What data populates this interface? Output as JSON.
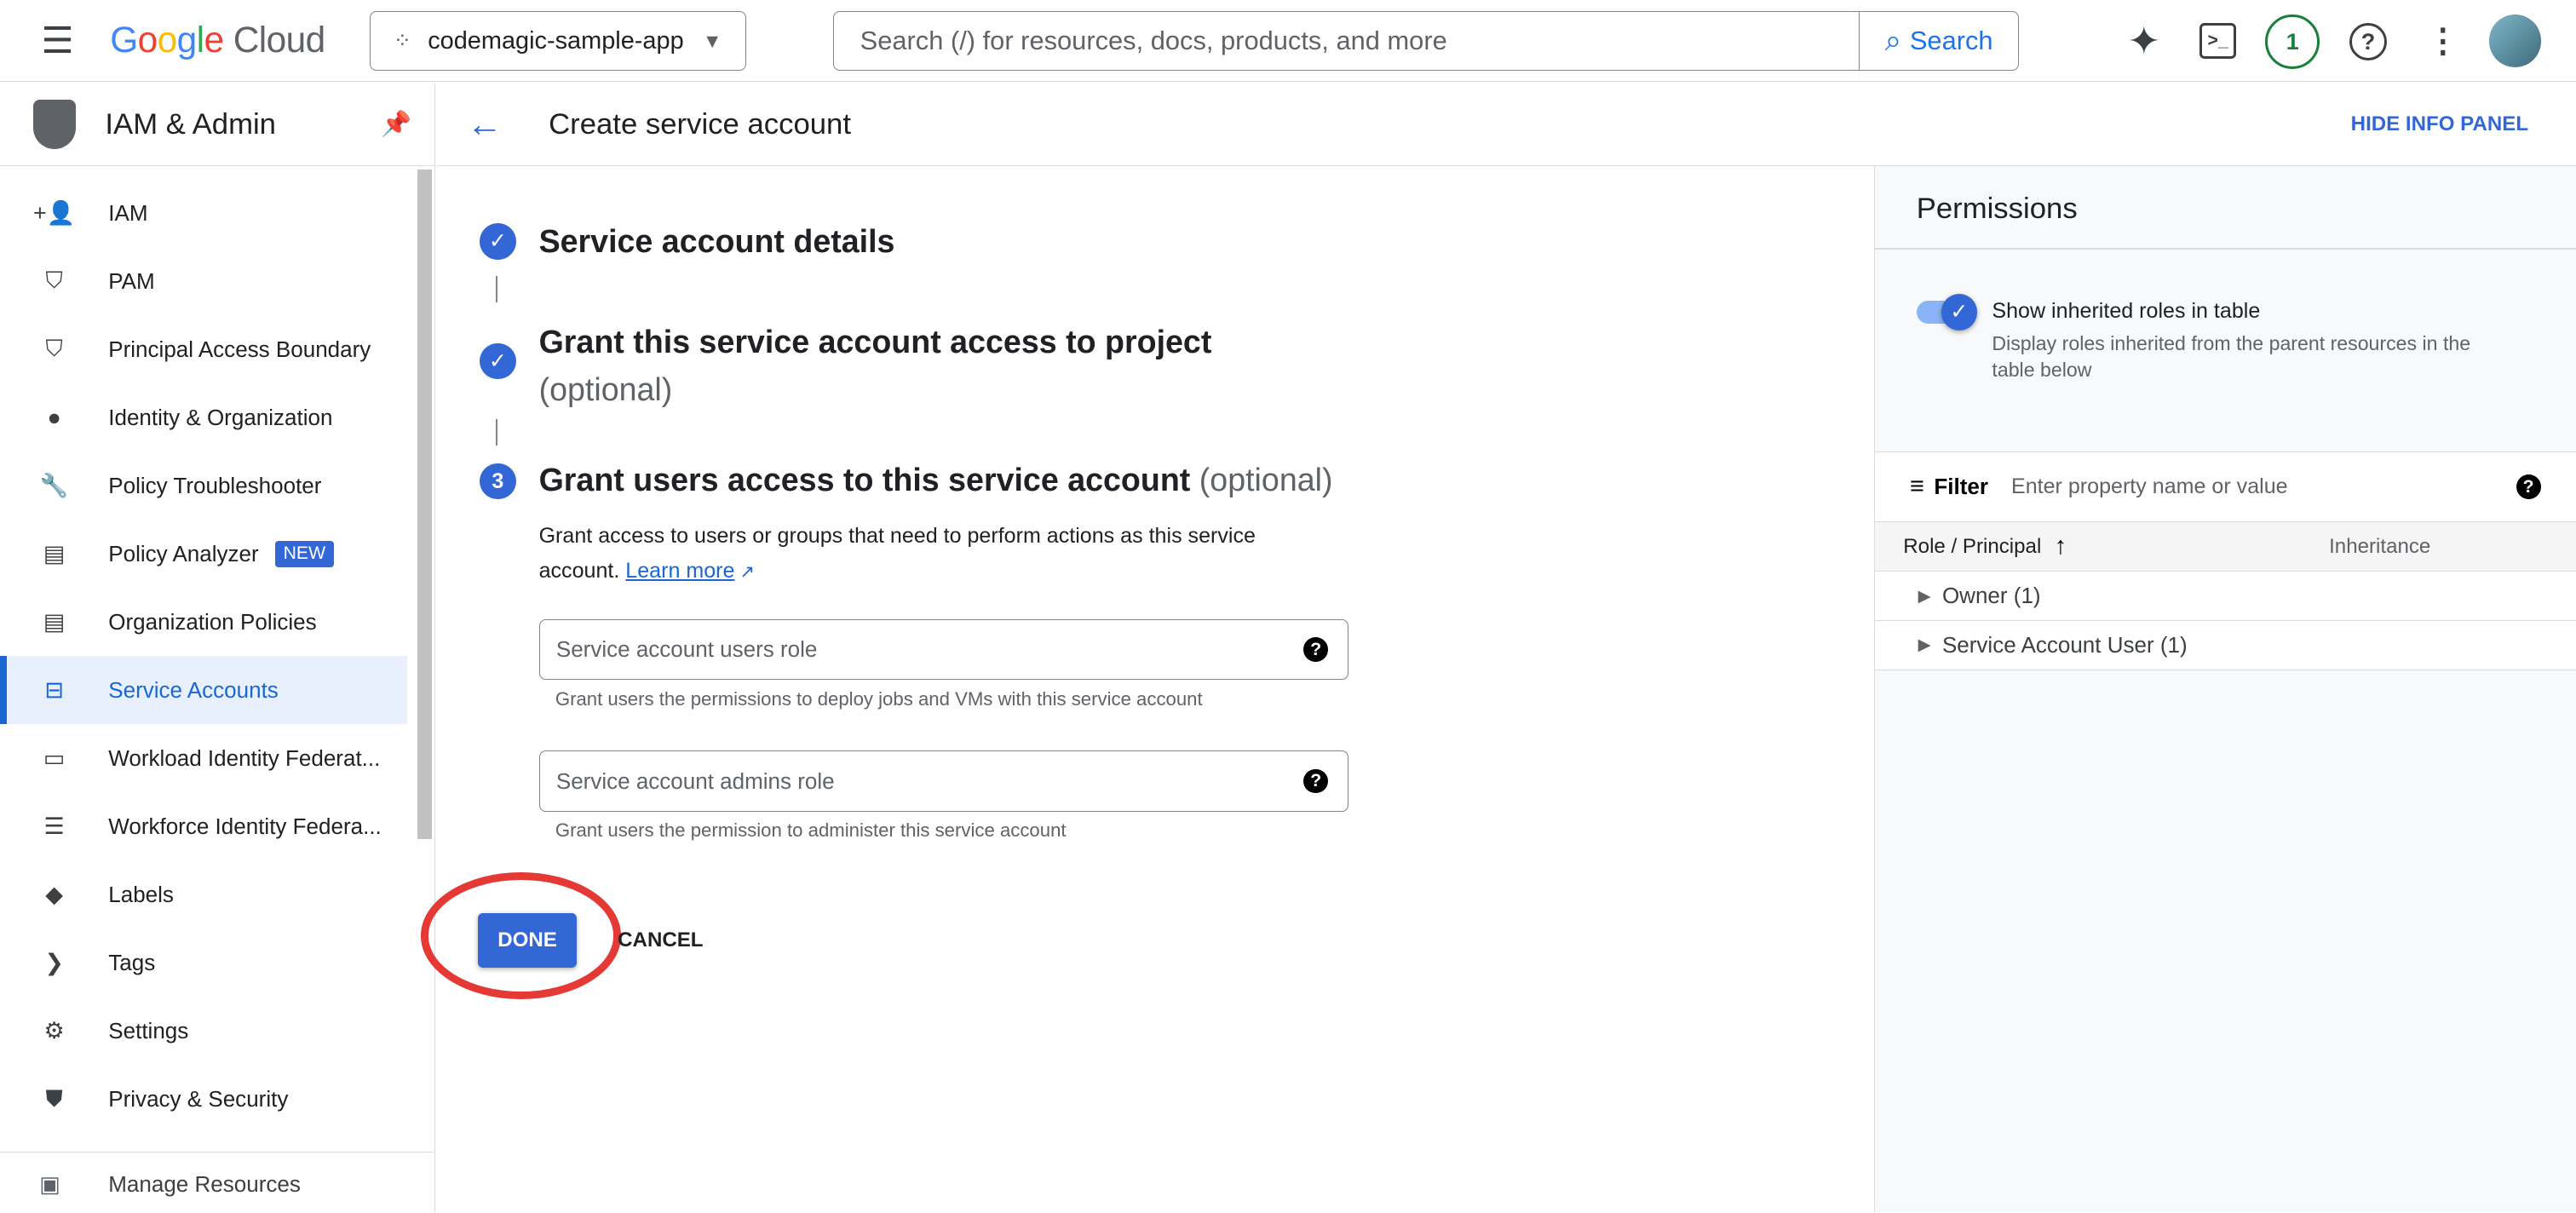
{
  "topbar": {
    "logo": "Google Cloud",
    "project": "codemagic-sample-app",
    "search_placeholder": "Search (/) for resources, docs, products, and more",
    "search_button": "Search",
    "notification_count": "1"
  },
  "sidebar": {
    "title": "IAM & Admin",
    "items": [
      {
        "label": "IAM",
        "icon": "person-add-icon",
        "glyph": "+👤"
      },
      {
        "label": "PAM",
        "icon": "shield-lock-icon",
        "glyph": "⛉"
      },
      {
        "label": "Principal Access Boundary",
        "icon": "shield-gear-icon",
        "glyph": "⛉"
      },
      {
        "label": "Identity & Organization",
        "icon": "account-circle-icon",
        "glyph": "●"
      },
      {
        "label": "Policy Troubleshooter",
        "icon": "wrench-icon",
        "glyph": "🔧"
      },
      {
        "label": "Policy Analyzer",
        "icon": "document-search-icon",
        "glyph": "▤",
        "badge": "NEW"
      },
      {
        "label": "Organization Policies",
        "icon": "list-document-icon",
        "glyph": "▤"
      },
      {
        "label": "Service Accounts",
        "icon": "service-account-icon",
        "glyph": "⊟",
        "active": true
      },
      {
        "label": "Workload Identity Federat...",
        "icon": "id-card-icon",
        "glyph": "▭"
      },
      {
        "label": "Workforce Identity Federa...",
        "icon": "list-icon",
        "glyph": "☰"
      },
      {
        "label": "Labels",
        "icon": "label-icon",
        "glyph": "◆"
      },
      {
        "label": "Tags",
        "icon": "tag-icon",
        "glyph": "❯"
      },
      {
        "label": "Settings",
        "icon": "gear-icon",
        "glyph": "⚙"
      },
      {
        "label": "Privacy & Security",
        "icon": "shield-icon",
        "glyph": "⛊"
      }
    ],
    "footer": "Manage Resources"
  },
  "page": {
    "title": "Create service account",
    "hide_panel": "HIDE INFO PANEL"
  },
  "steps": [
    {
      "title": "Service account details"
    },
    {
      "title": "Grant this service account access to project",
      "optional": "(optional)"
    },
    {
      "number": "3",
      "title": "Grant users access to this service account",
      "optional": "(optional)",
      "description": "Grant access to users or groups that need to perform actions as this service",
      "description2": "account.",
      "learn_more": "Learn more"
    }
  ],
  "fields": [
    {
      "placeholder": "Service account users role",
      "hint": "Grant users the permissions to deploy jobs and VMs with this service account"
    },
    {
      "placeholder": "Service account admins role",
      "hint": "Grant users the permission to administer this service account"
    }
  ],
  "actions": {
    "done": "DONE",
    "cancel": "CANCEL"
  },
  "panel": {
    "title": "Permissions",
    "toggle_label": "Show inherited roles in table",
    "toggle_on": true,
    "toggle_desc": "Display roles inherited from the parent resources in the table below",
    "filter_label": "Filter",
    "filter_placeholder": "Enter property name or value",
    "col_role": "Role / Principal",
    "col_inheritance": "Inheritance",
    "rows": [
      "Owner (1)",
      "Service Account User (1)"
    ]
  },
  "colors": {
    "accent": "#3367d6",
    "annotation": "#e53935"
  }
}
